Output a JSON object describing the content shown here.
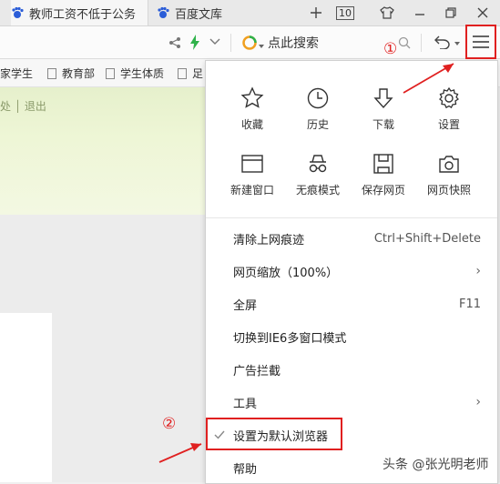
{
  "tabs": [
    {
      "label": "教师工资不低于公务"
    },
    {
      "label": "百度文库"
    }
  ],
  "tab_count": "10",
  "address": {
    "search_placeholder": "点此搜索"
  },
  "bookmarks": [
    {
      "label": "家学生"
    },
    {
      "label": "教育部"
    },
    {
      "label": "学生体质"
    },
    {
      "label": "足"
    }
  ],
  "page": {
    "links_text": "处 │ 退出"
  },
  "menu": {
    "grid": [
      {
        "label": "收藏",
        "icon": "star-icon"
      },
      {
        "label": "历史",
        "icon": "clock-icon"
      },
      {
        "label": "下载",
        "icon": "download-icon"
      },
      {
        "label": "设置",
        "icon": "gear-icon"
      },
      {
        "label": "新建窗口",
        "icon": "window-icon"
      },
      {
        "label": "无痕模式",
        "icon": "incognito-icon"
      },
      {
        "label": "保存网页",
        "icon": "save-icon"
      },
      {
        "label": "网页快照",
        "icon": "camera-icon"
      }
    ],
    "items": [
      {
        "label": "清除上网痕迹",
        "shortcut": "Ctrl+Shift+Delete"
      },
      {
        "label": "网页缩放（100%）",
        "shortcut": "›"
      },
      {
        "label": "全屏",
        "shortcut": "F11"
      },
      {
        "label": "切换到IE6多窗口模式",
        "shortcut": ""
      },
      {
        "label": "广告拦截",
        "shortcut": ""
      },
      {
        "label": "工具",
        "shortcut": "›"
      },
      {
        "label": "设置为默认浏览器",
        "shortcut": ""
      },
      {
        "label": "帮助",
        "shortcut": ""
      }
    ]
  },
  "annotations": {
    "step1": "①",
    "step2": "②",
    "color": "#e02020"
  },
  "watermark": "头条 @张光明老师"
}
